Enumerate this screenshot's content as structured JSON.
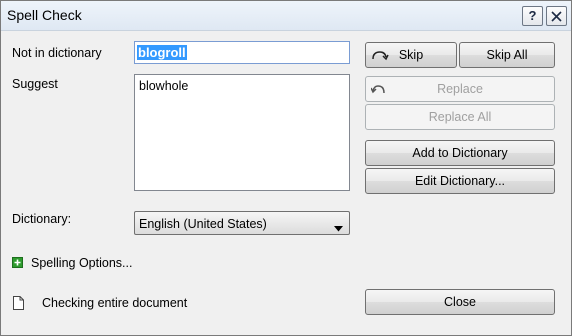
{
  "window": {
    "title": "Spell Check"
  },
  "titlebar": {
    "help_label": "?",
    "close_label": "×"
  },
  "fields": {
    "not_in_dictionary_label": "Not in dictionary",
    "not_in_dictionary_value": "blogroll",
    "suggest_label": "Suggest",
    "suggestions": [
      "blowhole"
    ],
    "dictionary_label": "Dictionary:",
    "dictionary_value": "English (United States)"
  },
  "buttons": {
    "skip": "Skip",
    "skip_all": "Skip All",
    "replace": "Replace",
    "replace_all": "Replace All",
    "add_to_dictionary": "Add to Dictionary",
    "edit_dictionary": "Edit Dictionary...",
    "close": "Close"
  },
  "options": {
    "spelling_options": "Spelling Options..."
  },
  "status": {
    "text": "Checking entire document"
  },
  "icons": {
    "help": "help-icon",
    "close": "close-icon",
    "skip": "skip-arrow-icon",
    "replace": "replace-arrow-icon",
    "expand": "expand-plus-icon",
    "document": "document-icon",
    "dropdown": "chevron-down-icon"
  },
  "colors": {
    "selection": "#3399ff",
    "expand_green": "#2e9b2e",
    "disabled_text": "#a0a0a0"
  }
}
